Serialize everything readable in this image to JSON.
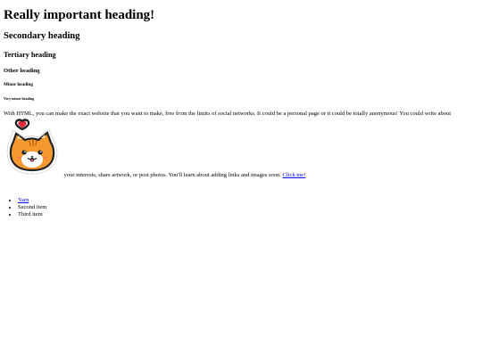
{
  "headings": {
    "h1": "Really important heading!",
    "h2": "Secondary heading",
    "h3": "Tertiary heading",
    "h4": "Other heading",
    "h5": "Minor heading",
    "h6": "Very minor heading"
  },
  "paragraph": {
    "before_image": "With HTML, you can make the exact website that you want to make, free from the limits of social networks. It could be a personal page or it could be totally anonymous! You could write about",
    "after_image": "your interests, share artwork, or post photos. You'll learn about adding links and images soon.",
    "link_label": "Click me!",
    "image_icon": "cat-with-heart-sticker-icon"
  },
  "list": {
    "items": [
      {
        "label": "Yarn",
        "is_link": true
      },
      {
        "label": "Second item",
        "is_link": false
      },
      {
        "label": "Third item",
        "is_link": false
      }
    ]
  },
  "colors": {
    "link": "#0000ee",
    "text": "#000000",
    "cat_orange": "#f59a2f",
    "heart": "#e0283a"
  }
}
